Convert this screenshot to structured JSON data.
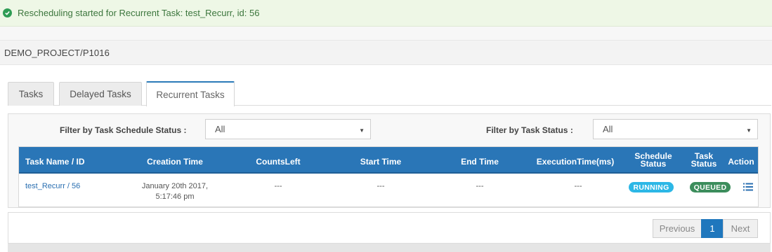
{
  "alert": {
    "message": "Rescheduling started for Recurrent Task: test_Recurr, id: 56",
    "icon": "check-circle-icon",
    "color": "#3c763d"
  },
  "breadcrumb": "DEMO_PROJECT/P1016",
  "tabs": [
    {
      "label": "Tasks",
      "active": false
    },
    {
      "label": "Delayed Tasks",
      "active": false
    },
    {
      "label": "Recurrent Tasks",
      "active": true
    }
  ],
  "filters": {
    "schedule_label": "Filter by Task Schedule Status :",
    "schedule_value": "All",
    "task_label": "Filter by Task Status :",
    "task_value": "All"
  },
  "table": {
    "headers": {
      "name": "Task Name / ID",
      "creation": "Creation Time",
      "counts": "CountsLeft",
      "start": "Start Time",
      "end": "End Time",
      "exec": "ExecutionTime(ms)",
      "schedule_line1": "Schedule",
      "schedule_line2": "Status",
      "task_line1": "Task",
      "task_line2": "Status",
      "action": "Action"
    },
    "rows": [
      {
        "name": "test_Recurr / 56",
        "creation_line1": "January 20th 2017,",
        "creation_line2": "5:17:46 pm",
        "counts": "---",
        "start": "---",
        "end": "---",
        "exec": "---",
        "schedule_status": "RUNNING",
        "task_status": "QUEUED",
        "action_icon": "list-icon"
      }
    ]
  },
  "pagination": {
    "previous": "Previous",
    "current": "1",
    "next": "Next"
  },
  "colors": {
    "accent": "#2a76b7",
    "running": "#2cb7e6",
    "queued": "#3c8d5c",
    "alert_bg": "#eef7e6"
  }
}
